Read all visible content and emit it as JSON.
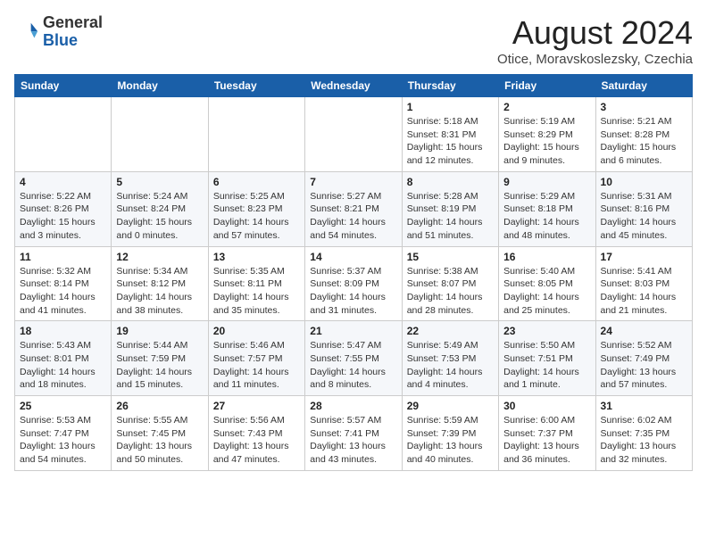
{
  "header": {
    "logo_line1": "General",
    "logo_line2": "Blue",
    "month_year": "August 2024",
    "location": "Otice, Moravskoslezsky, Czechia"
  },
  "days_of_week": [
    "Sunday",
    "Monday",
    "Tuesday",
    "Wednesday",
    "Thursday",
    "Friday",
    "Saturday"
  ],
  "weeks": [
    [
      {
        "day": "",
        "info": ""
      },
      {
        "day": "",
        "info": ""
      },
      {
        "day": "",
        "info": ""
      },
      {
        "day": "",
        "info": ""
      },
      {
        "day": "1",
        "info": "Sunrise: 5:18 AM\nSunset: 8:31 PM\nDaylight: 15 hours\nand 12 minutes."
      },
      {
        "day": "2",
        "info": "Sunrise: 5:19 AM\nSunset: 8:29 PM\nDaylight: 15 hours\nand 9 minutes."
      },
      {
        "day": "3",
        "info": "Sunrise: 5:21 AM\nSunset: 8:28 PM\nDaylight: 15 hours\nand 6 minutes."
      }
    ],
    [
      {
        "day": "4",
        "info": "Sunrise: 5:22 AM\nSunset: 8:26 PM\nDaylight: 15 hours\nand 3 minutes."
      },
      {
        "day": "5",
        "info": "Sunrise: 5:24 AM\nSunset: 8:24 PM\nDaylight: 15 hours\nand 0 minutes."
      },
      {
        "day": "6",
        "info": "Sunrise: 5:25 AM\nSunset: 8:23 PM\nDaylight: 14 hours\nand 57 minutes."
      },
      {
        "day": "7",
        "info": "Sunrise: 5:27 AM\nSunset: 8:21 PM\nDaylight: 14 hours\nand 54 minutes."
      },
      {
        "day": "8",
        "info": "Sunrise: 5:28 AM\nSunset: 8:19 PM\nDaylight: 14 hours\nand 51 minutes."
      },
      {
        "day": "9",
        "info": "Sunrise: 5:29 AM\nSunset: 8:18 PM\nDaylight: 14 hours\nand 48 minutes."
      },
      {
        "day": "10",
        "info": "Sunrise: 5:31 AM\nSunset: 8:16 PM\nDaylight: 14 hours\nand 45 minutes."
      }
    ],
    [
      {
        "day": "11",
        "info": "Sunrise: 5:32 AM\nSunset: 8:14 PM\nDaylight: 14 hours\nand 41 minutes."
      },
      {
        "day": "12",
        "info": "Sunrise: 5:34 AM\nSunset: 8:12 PM\nDaylight: 14 hours\nand 38 minutes."
      },
      {
        "day": "13",
        "info": "Sunrise: 5:35 AM\nSunset: 8:11 PM\nDaylight: 14 hours\nand 35 minutes."
      },
      {
        "day": "14",
        "info": "Sunrise: 5:37 AM\nSunset: 8:09 PM\nDaylight: 14 hours\nand 31 minutes."
      },
      {
        "day": "15",
        "info": "Sunrise: 5:38 AM\nSunset: 8:07 PM\nDaylight: 14 hours\nand 28 minutes."
      },
      {
        "day": "16",
        "info": "Sunrise: 5:40 AM\nSunset: 8:05 PM\nDaylight: 14 hours\nand 25 minutes."
      },
      {
        "day": "17",
        "info": "Sunrise: 5:41 AM\nSunset: 8:03 PM\nDaylight: 14 hours\nand 21 minutes."
      }
    ],
    [
      {
        "day": "18",
        "info": "Sunrise: 5:43 AM\nSunset: 8:01 PM\nDaylight: 14 hours\nand 18 minutes."
      },
      {
        "day": "19",
        "info": "Sunrise: 5:44 AM\nSunset: 7:59 PM\nDaylight: 14 hours\nand 15 minutes."
      },
      {
        "day": "20",
        "info": "Sunrise: 5:46 AM\nSunset: 7:57 PM\nDaylight: 14 hours\nand 11 minutes."
      },
      {
        "day": "21",
        "info": "Sunrise: 5:47 AM\nSunset: 7:55 PM\nDaylight: 14 hours\nand 8 minutes."
      },
      {
        "day": "22",
        "info": "Sunrise: 5:49 AM\nSunset: 7:53 PM\nDaylight: 14 hours\nand 4 minutes."
      },
      {
        "day": "23",
        "info": "Sunrise: 5:50 AM\nSunset: 7:51 PM\nDaylight: 14 hours\nand 1 minute."
      },
      {
        "day": "24",
        "info": "Sunrise: 5:52 AM\nSunset: 7:49 PM\nDaylight: 13 hours\nand 57 minutes."
      }
    ],
    [
      {
        "day": "25",
        "info": "Sunrise: 5:53 AM\nSunset: 7:47 PM\nDaylight: 13 hours\nand 54 minutes."
      },
      {
        "day": "26",
        "info": "Sunrise: 5:55 AM\nSunset: 7:45 PM\nDaylight: 13 hours\nand 50 minutes."
      },
      {
        "day": "27",
        "info": "Sunrise: 5:56 AM\nSunset: 7:43 PM\nDaylight: 13 hours\nand 47 minutes."
      },
      {
        "day": "28",
        "info": "Sunrise: 5:57 AM\nSunset: 7:41 PM\nDaylight: 13 hours\nand 43 minutes."
      },
      {
        "day": "29",
        "info": "Sunrise: 5:59 AM\nSunset: 7:39 PM\nDaylight: 13 hours\nand 40 minutes."
      },
      {
        "day": "30",
        "info": "Sunrise: 6:00 AM\nSunset: 7:37 PM\nDaylight: 13 hours\nand 36 minutes."
      },
      {
        "day": "31",
        "info": "Sunrise: 6:02 AM\nSunset: 7:35 PM\nDaylight: 13 hours\nand 32 minutes."
      }
    ]
  ]
}
